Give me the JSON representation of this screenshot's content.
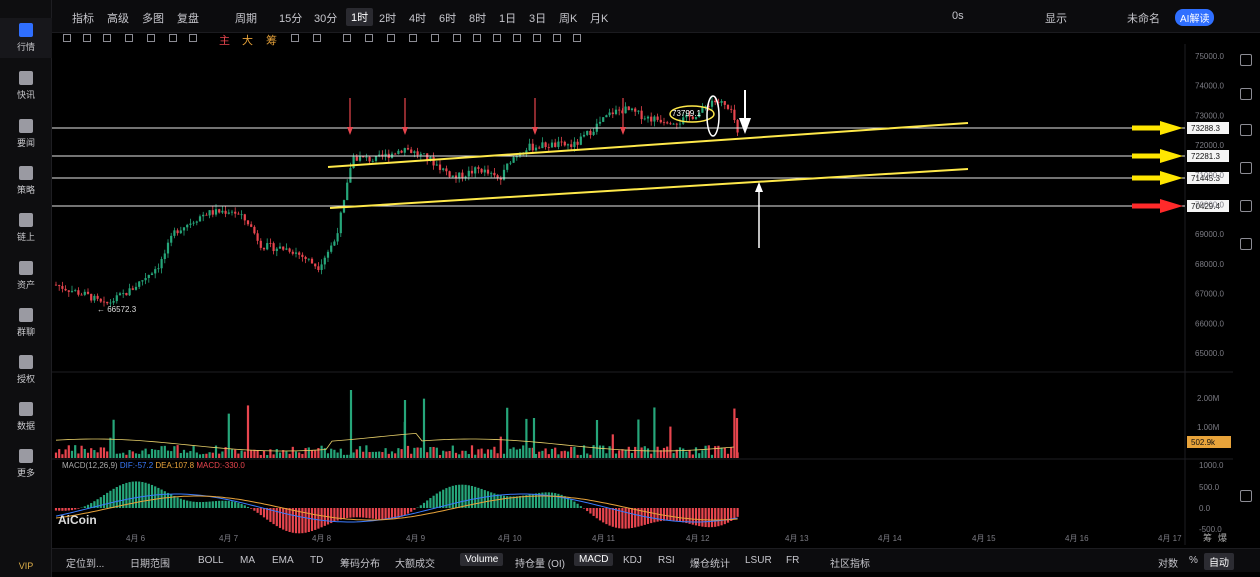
{
  "sidebar": {
    "items": [
      {
        "label": "行情",
        "icon": "chart-icon"
      },
      {
        "label": "快讯",
        "icon": "news-icon"
      },
      {
        "label": "要闻",
        "icon": "article-icon"
      },
      {
        "label": "策略",
        "icon": "robot-icon"
      },
      {
        "label": "链上",
        "icon": "chain-icon"
      },
      {
        "label": "资产",
        "icon": "wallet-icon"
      },
      {
        "label": "群聊",
        "icon": "chat-icon"
      },
      {
        "label": "授权",
        "icon": "auth-icon"
      },
      {
        "label": "数据",
        "icon": "data-icon"
      },
      {
        "label": "更多",
        "icon": "more-icon"
      }
    ],
    "vip": "VIP"
  },
  "topbar": {
    "indicator": "指标",
    "advanced": "高级",
    "multi": "多图",
    "replay": "复盘",
    "period": "周期",
    "intervals": [
      "15分",
      "30分",
      "1时",
      "2时",
      "4时",
      "6时",
      "8时",
      "1日",
      "3日",
      "周K",
      "月K"
    ],
    "active_interval": "1时",
    "timer": "0s",
    "display": "显示",
    "unnamed": "未命名",
    "ai_label": "AI解读"
  },
  "toolbar": {
    "main": "主",
    "big": "大",
    "chips": "筹"
  },
  "price_axis": {
    "ticks": [
      "75000.0",
      "74000.0",
      "73000.0",
      "72000.0",
      "71000.0",
      "70000.0",
      "69000.0",
      "68000.0",
      "67000.0",
      "66000.0",
      "65000.0"
    ]
  },
  "price_tags": [
    {
      "value": "73288.3",
      "arrow_color": "#ffe600"
    },
    {
      "value": "72281.3",
      "arrow_color": "#ffe600"
    },
    {
      "value": "71445.3",
      "arrow_color": "#ffe600"
    },
    {
      "value": "70429.4",
      "arrow_color": "#ff2a2a"
    }
  ],
  "annotations": {
    "high_label": "73799.1",
    "low_label": "← 66572.3"
  },
  "volume": {
    "ticks": [
      "2.00M",
      "1.00M"
    ],
    "current": "502.9k"
  },
  "macd": {
    "title": "MACD(12,26,9)",
    "dif": "DIF:-57.2",
    "dea": "DEA:107.8",
    "macd": "MACD:-330.0",
    "ticks": [
      "1000.0",
      "500.0",
      "0.0",
      "-500.0"
    ]
  },
  "brand": "AiCoin",
  "dates": [
    "4月 6",
    "4月 7",
    "4月 8",
    "4月 9",
    "4月 10",
    "4月 11",
    "4月 12",
    "4月 13",
    "4月 14",
    "4月 15",
    "4月 16",
    "4月 17"
  ],
  "axis_corner": [
    "筹",
    "爆"
  ],
  "bottombar": {
    "locate": "定位到...",
    "date_range": "日期范围",
    "items": [
      "BOLL",
      "MA",
      "EMA",
      "TD",
      "筹码分布",
      "大额成交"
    ],
    "items2": [
      "Volume",
      "持仓量 (OI)",
      "MACD",
      "KDJ",
      "RSI",
      "爆仓统计",
      "LSUR",
      "FR",
      "社区指标"
    ],
    "right": [
      "对数",
      "%",
      "自动"
    ]
  },
  "colors": {
    "up": "#26a67a",
    "down": "#e8454e",
    "accent": "#2f6fff",
    "trendline": "#ffe94a"
  }
}
